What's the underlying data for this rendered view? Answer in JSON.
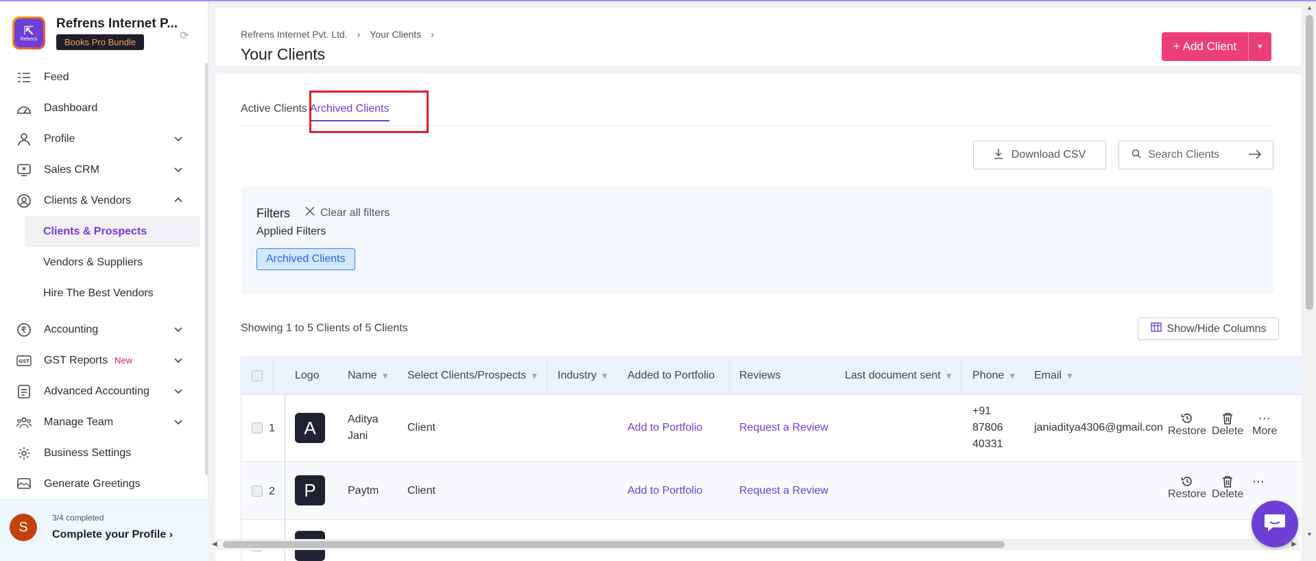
{
  "org": {
    "name": "Refrens Internet P...",
    "plan_badge": "Books Pro Bundle",
    "logo_text": "Refrens"
  },
  "nav": {
    "feed": "Feed",
    "dashboard": "Dashboard",
    "profile": "Profile",
    "sales_crm": "Sales CRM",
    "clients_vendors": "Clients & Vendors",
    "sub_clients_prospects": "Clients & Prospects",
    "sub_vendors_suppliers": "Vendors & Suppliers",
    "sub_hire_vendors": "Hire The Best Vendors",
    "accounting": "Accounting",
    "gst_reports": "GST Reports",
    "gst_badge": "New",
    "advanced_accounting": "Advanced Accounting",
    "manage_team": "Manage Team",
    "business_settings": "Business Settings",
    "generate_greetings": "Generate Greetings"
  },
  "profile_card": {
    "avatar_initial": "S",
    "progress": "3/4 completed",
    "cta": "Complete your Profile"
  },
  "header": {
    "breadcrumb_org": "Refrens Internet Pvt. Ltd.",
    "breadcrumb_current": "Your Clients",
    "title": "Your Clients",
    "add_client": "+ Add Client"
  },
  "tabs": {
    "active": "Active Clients",
    "archived": "Archived Clients"
  },
  "toolbar": {
    "download_csv": "Download CSV",
    "search_placeholder": "Search Clients"
  },
  "filters": {
    "title": "Filters",
    "clear_all": "Clear all filters",
    "applied_label": "Applied Filters",
    "chip": "Archived Clients"
  },
  "listing": {
    "showing": "Showing 1 to 5 Clients of 5 Clients",
    "show_hide_columns": "Show/Hide Columns"
  },
  "table": {
    "columns": {
      "logo": "Logo",
      "name": "Name",
      "type": "Select Clients/Prospects",
      "industry": "Industry",
      "portfolio": "Added to Portfolio",
      "reviews": "Reviews",
      "last_doc": "Last document sent",
      "phone": "Phone",
      "email": "Email"
    },
    "rows": [
      {
        "num": "1",
        "initial": "A",
        "name_line1": "Aditya",
        "name_line2": "Jani",
        "type": "Client",
        "portfolio": "Add to Portfolio",
        "review": "Request a Review",
        "phone_line1": "+91",
        "phone_line2": "87806",
        "phone_line3": "40331",
        "email": "janiaditya4306@gmail.con",
        "restore": "Restore",
        "delete": "Delete",
        "more": "More"
      },
      {
        "num": "2",
        "initial": "P",
        "name": "Paytm",
        "type": "Client",
        "portfolio": "Add to Portfolio",
        "review": "Request a Review",
        "restore": "Restore",
        "delete": "Delete"
      }
    ]
  },
  "colors": {
    "accent": "#6d3fd6",
    "primary_button": "#ec3f7a",
    "highlight": "#d9202c"
  }
}
